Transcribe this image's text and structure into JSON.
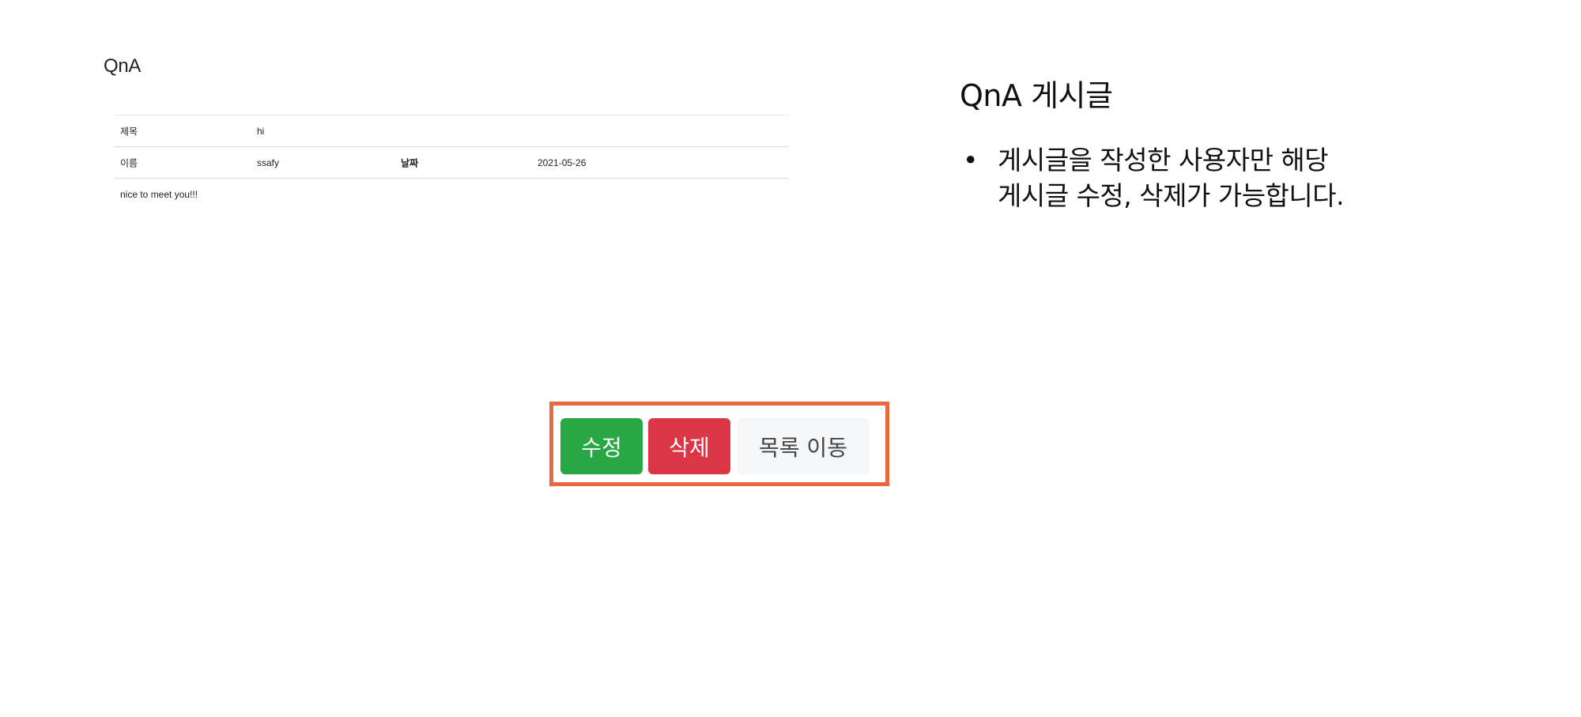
{
  "page": {
    "title": "QnA"
  },
  "article": {
    "subject_label": "제목",
    "subject_value": "hi",
    "name_label": "이름",
    "name_value": "ssafy",
    "date_label": "날짜",
    "date_value": "2021-05-26",
    "content": "nice to meet you!!!"
  },
  "buttons": {
    "edit_label": "수정",
    "delete_label": "삭제",
    "list_label": "목록 이동"
  },
  "description": {
    "title": "QnA 게시글",
    "bullet": "•",
    "lines": [
      "게시글을 작성한 사용자만 해당",
      "게시글 수정, 삭제가 가능합니다."
    ]
  },
  "colors": {
    "edit_button": "#28a745",
    "delete_button": "#dc3545",
    "list_button": "#f5f6f8",
    "highlight_border": "#e8683f"
  }
}
